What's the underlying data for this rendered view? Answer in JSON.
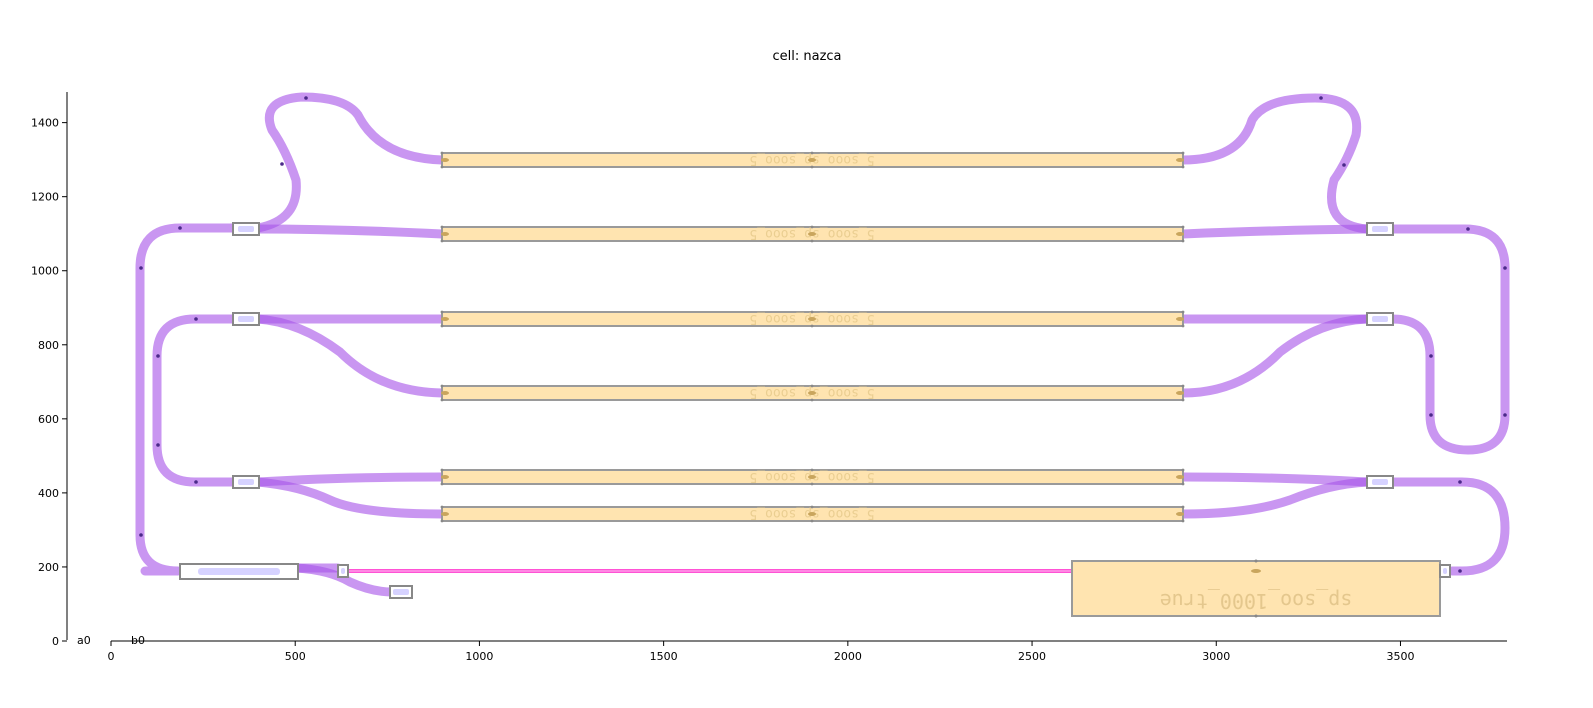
{
  "title": "cell: nazca",
  "corner_labels": [
    "a0",
    "b0"
  ],
  "x_axis": {
    "ticks": [
      0,
      500,
      1000,
      1500,
      2000,
      2500,
      3000,
      3500
    ],
    "range": [
      0,
      3800
    ]
  },
  "y_axis": {
    "ticks": [
      0,
      200,
      400,
      600,
      800,
      1000,
      1200,
      1400
    ],
    "range": [
      0,
      1480
    ]
  },
  "components": {
    "mmi_label": "sp_soo_1000_true",
    "strip_labels": [
      "5_sooo_sp_sooo_5",
      "5_sooo_sp_sooo_5",
      "5_sooo_sp_sooo_5",
      "5_sooo_sp_sooo_5",
      "5_sooo_sp_sooo_5",
      "5_sooo_sp_sooo_5"
    ]
  },
  "colors": {
    "waveguide": "#a855e8",
    "strip_fill": "#ffe4b0",
    "highlight": "#ff3fd0",
    "outline": "#9a9a9a"
  },
  "chart_data": {
    "type": "layout",
    "title": "cell: nazca",
    "x_ticks": [
      0,
      500,
      1000,
      1500,
      2000,
      2500,
      3000,
      3500
    ],
    "y_ticks": [
      0,
      200,
      400,
      600,
      800,
      1000,
      1200,
      1400
    ]
  }
}
